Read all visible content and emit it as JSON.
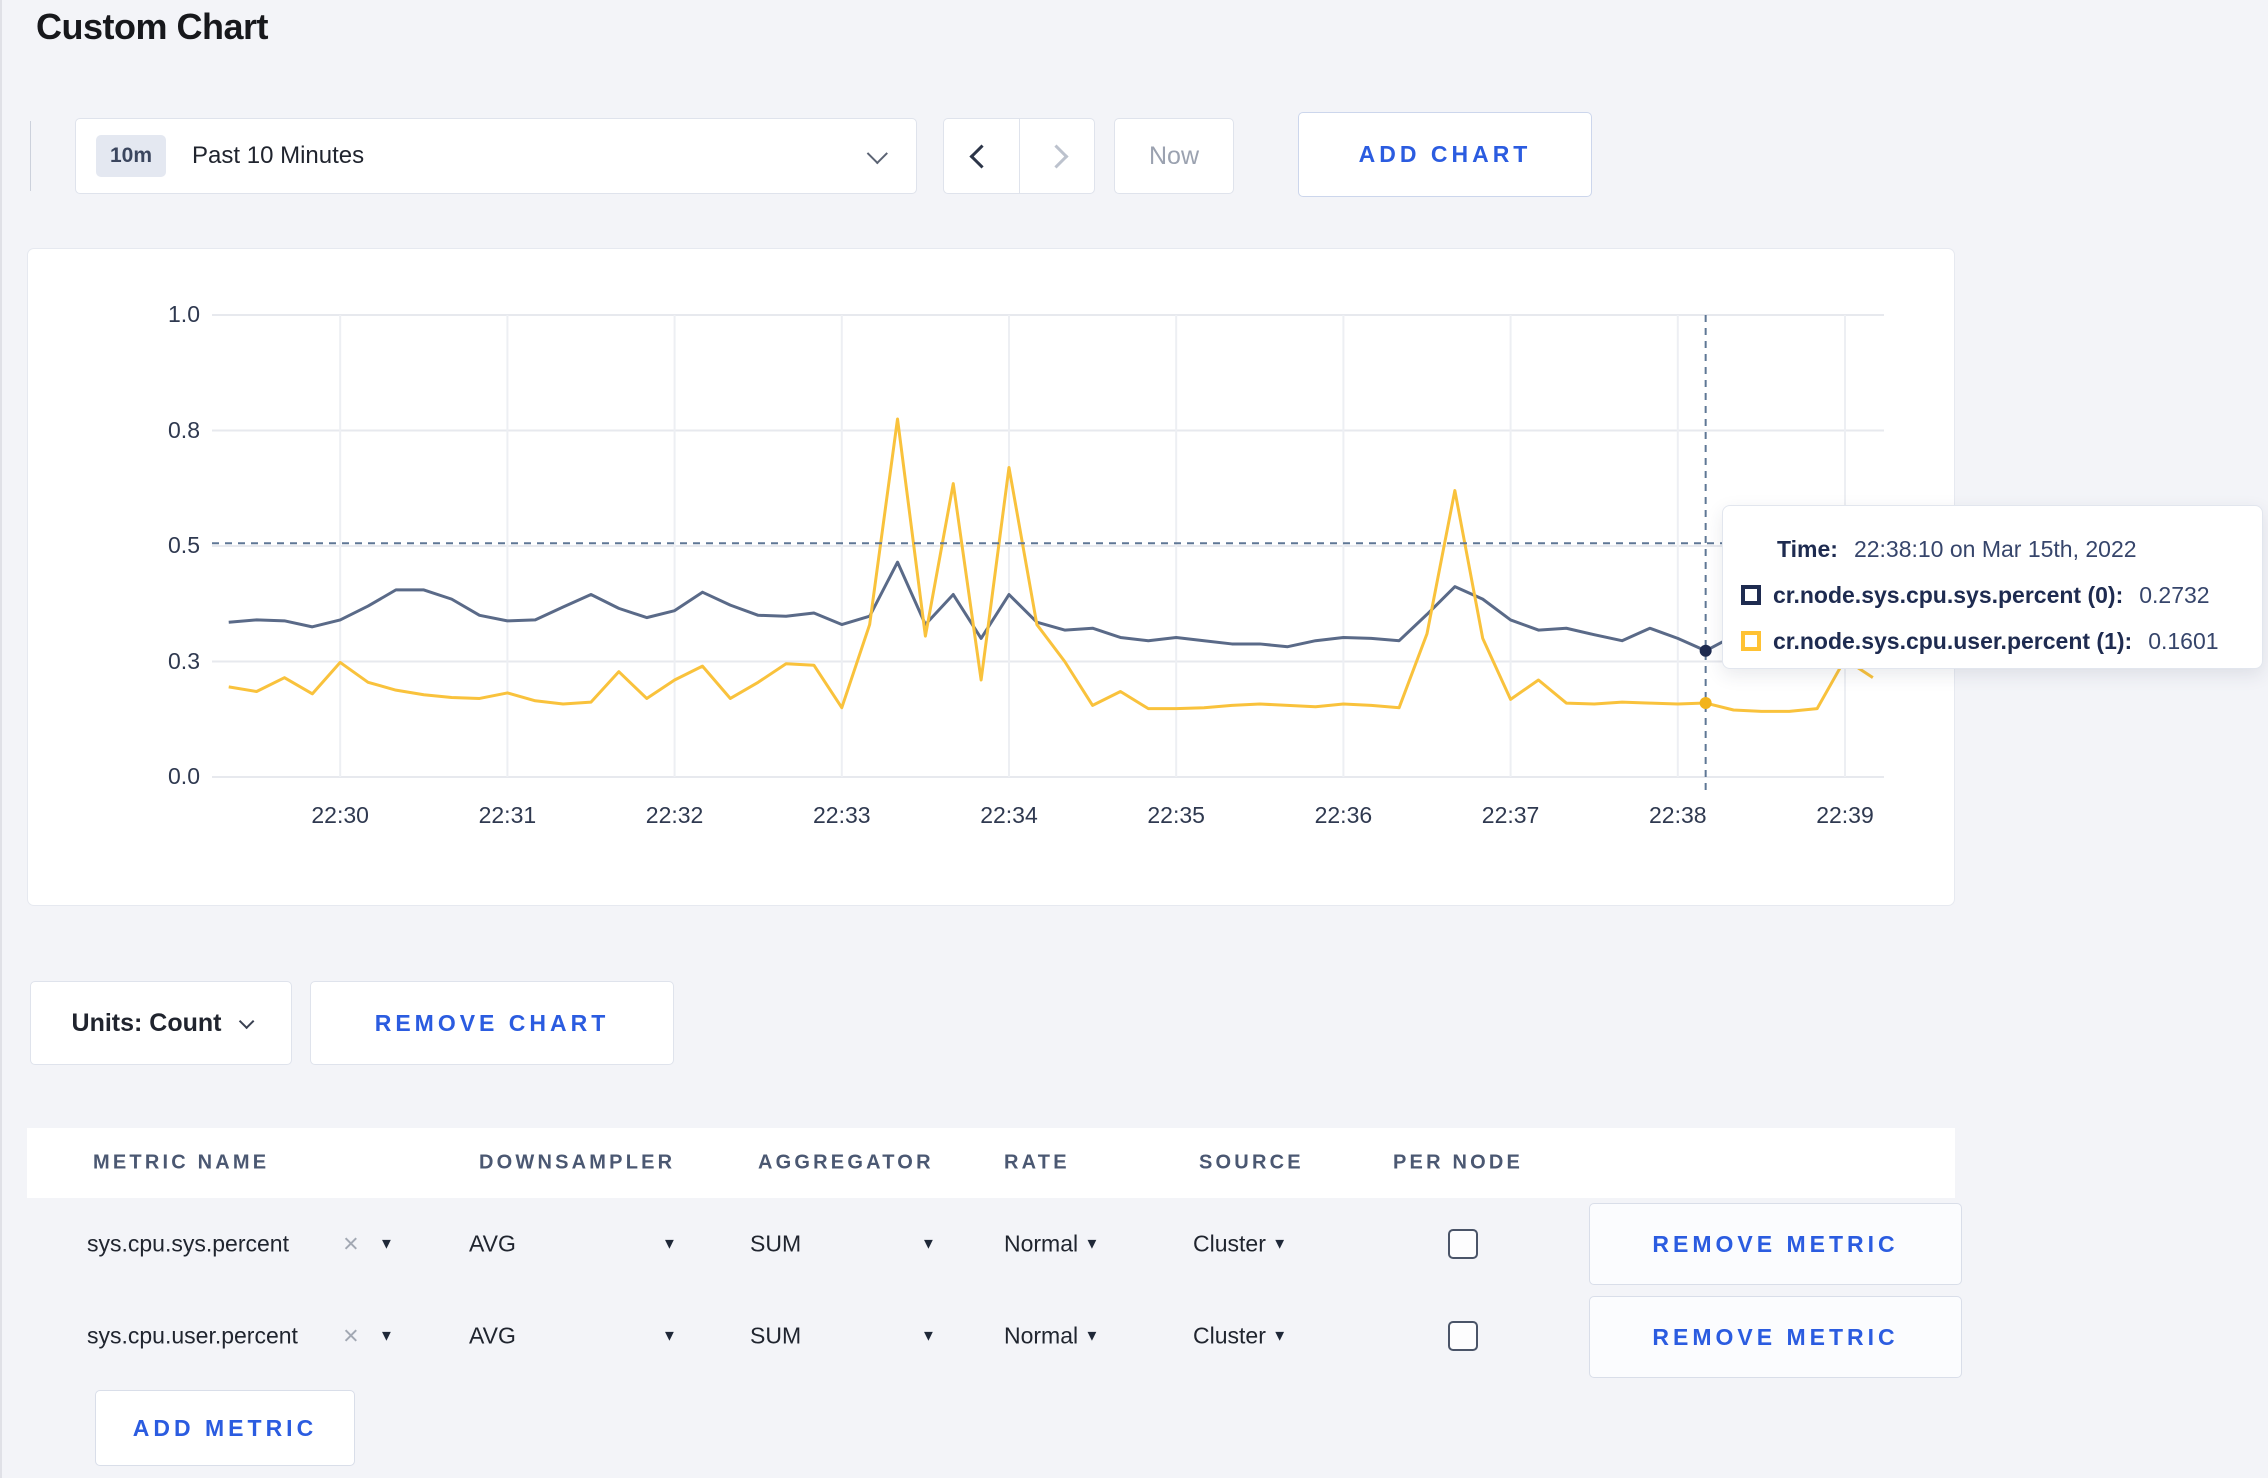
{
  "page": {
    "title": "Custom Chart",
    "background": "#f3f4f8",
    "accent_blue": "#2b5ce0"
  },
  "icons": {
    "caret_down": "▼",
    "clear": "×"
  },
  "toolbar": {
    "time_range": {
      "badge": "10m",
      "label": "Past 10 Minutes"
    },
    "now_label": "Now",
    "add_chart_label": "ADD CHART"
  },
  "chart_data": {
    "type": "line",
    "title": "",
    "xlabel": "",
    "ylabel": "",
    "x_axis": {
      "duration_s": 600,
      "first_tick_offset_s": 46,
      "tick_interval_s": 60,
      "tick_labels": [
        "22:30",
        "22:31",
        "22:32",
        "22:33",
        "22:34",
        "22:35",
        "22:36",
        "22:37",
        "22:38",
        "22:39"
      ]
    },
    "y_axis": {
      "ylim": [
        0,
        1
      ],
      "ticks": [
        {
          "value": 0.0,
          "label": "0.0"
        },
        {
          "value": 0.25,
          "label": "0.3"
        },
        {
          "value": 0.5,
          "label": "0.5"
        },
        {
          "value": 0.75,
          "label": "0.8"
        },
        {
          "value": 1.0,
          "label": "1.0"
        }
      ]
    },
    "sampling": {
      "first_sample_offset_s": 6,
      "interval_s": 10
    },
    "series": [
      {
        "name": "cr.node.sys.cpu.sys.percent (0)",
        "color": "#5a6a88",
        "values": [
          0.335,
          0.34,
          0.338,
          0.325,
          0.34,
          0.37,
          0.405,
          0.405,
          0.385,
          0.35,
          0.338,
          0.34,
          0.368,
          0.395,
          0.365,
          0.345,
          0.36,
          0.4,
          0.372,
          0.35,
          0.348,
          0.355,
          0.33,
          0.348,
          0.465,
          0.33,
          0.395,
          0.3,
          0.395,
          0.335,
          0.318,
          0.322,
          0.302,
          0.295,
          0.302,
          0.295,
          0.288,
          0.288,
          0.282,
          0.295,
          0.302,
          0.3,
          0.295,
          0.352,
          0.412,
          0.385,
          0.34,
          0.318,
          0.322,
          0.308,
          0.295,
          0.322,
          0.3,
          0.2732,
          0.305,
          0.33,
          0.305,
          0.295,
          0.295,
          0.31
        ]
      },
      {
        "name": "cr.node.sys.cpu.user.percent (1)",
        "color": "#f9c23c",
        "values": [
          0.195,
          0.185,
          0.215,
          0.18,
          0.248,
          0.205,
          0.188,
          0.178,
          0.172,
          0.17,
          0.182,
          0.165,
          0.158,
          0.162,
          0.228,
          0.17,
          0.21,
          0.24,
          0.17,
          0.205,
          0.245,
          0.242,
          0.15,
          0.33,
          0.775,
          0.305,
          0.635,
          0.21,
          0.67,
          0.33,
          0.25,
          0.155,
          0.185,
          0.148,
          0.148,
          0.15,
          0.155,
          0.158,
          0.155,
          0.152,
          0.158,
          0.155,
          0.15,
          0.31,
          0.62,
          0.3,
          0.168,
          0.21,
          0.16,
          0.158,
          0.162,
          0.16,
          0.158,
          0.1601,
          0.145,
          0.142,
          0.142,
          0.148,
          0.255,
          0.215
        ]
      }
    ],
    "grid": true,
    "legend_position": "tooltip",
    "hover": {
      "offset_s": 536,
      "time_label": "22:38:10",
      "guide_value": 0.506,
      "points": [
        {
          "value": 0.2732,
          "color": "#1e2b50"
        },
        {
          "value": 0.1601,
          "color": "#f2b31c"
        }
      ]
    }
  },
  "tooltip": {
    "time_label": "Time:",
    "time_value": "22:38:10 on Mar 15th, 2022",
    "rows": [
      {
        "label": "cr.node.sys.cpu.sys.percent (0):",
        "value": "0.2732",
        "swatch": "#1e2b50"
      },
      {
        "label": "cr.node.sys.cpu.user.percent (1):",
        "value": "0.1601",
        "swatch": "#ffc233"
      }
    ]
  },
  "units": {
    "label": "Units: Count"
  },
  "actions": {
    "remove_chart_label": "REMOVE CHART",
    "add_metric_label": "ADD METRIC"
  },
  "metrics": {
    "headers": [
      "METRIC NAME",
      "DOWNSAMPLER",
      "AGGREGATOR",
      "RATE",
      "SOURCE",
      "PER NODE"
    ],
    "rows": [
      {
        "name": "sys.cpu.sys.percent",
        "downsampler": "AVG",
        "aggregator": "SUM",
        "rate": "Normal",
        "source": "Cluster",
        "per_node_checked": false,
        "remove_label": "REMOVE METRIC"
      },
      {
        "name": "sys.cpu.user.percent",
        "downsampler": "AVG",
        "aggregator": "SUM",
        "rate": "Normal",
        "source": "Cluster",
        "per_node_checked": false,
        "remove_label": "REMOVE METRIC"
      }
    ]
  }
}
